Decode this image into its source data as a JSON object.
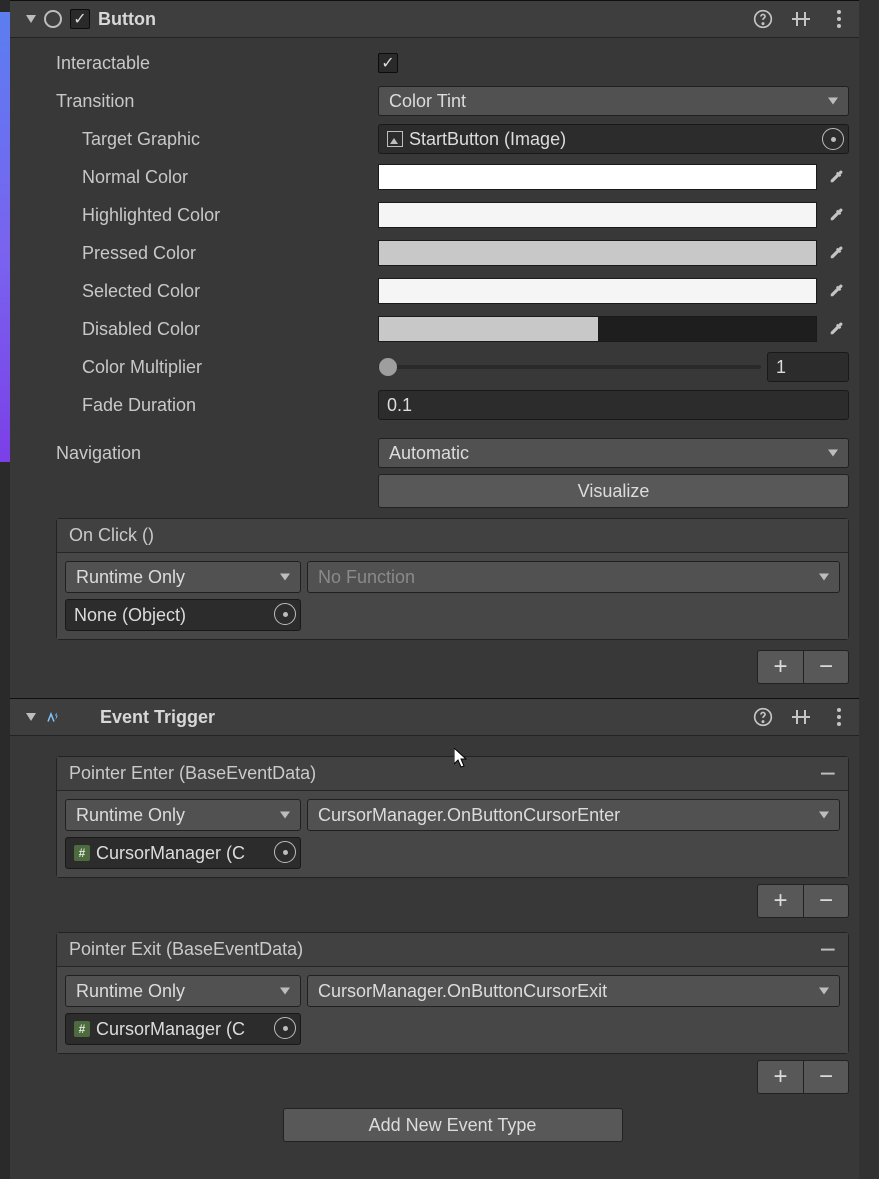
{
  "button": {
    "title": "Button",
    "enabled": true,
    "interactable_label": "Interactable",
    "interactable_on": true,
    "transition_label": "Transition",
    "transition_value": "Color Tint",
    "target_graphic_label": "Target Graphic",
    "target_graphic_value": "StartButton (Image)",
    "normal_color_label": "Normal Color",
    "normal_color_value": "#ffffff",
    "highlighted_color_label": "Highlighted Color",
    "highlighted_color_value": "#f5f5f5",
    "pressed_color_label": "Pressed Color",
    "pressed_color_value": "#c8c8c8",
    "selected_color_label": "Selected Color",
    "selected_color_value": "#f5f5f5",
    "disabled_color_label": "Disabled Color",
    "disabled_color_a": "#c8c8c8",
    "disabled_color_b": "#1e1e1e",
    "color_multiplier_label": "Color Multiplier",
    "color_multiplier_value": "1",
    "fade_duration_label": "Fade Duration",
    "fade_duration_value": "0.1",
    "navigation_label": "Navigation",
    "navigation_value": "Automatic",
    "visualize_label": "Visualize",
    "onclick": {
      "header": "On Click ()",
      "callstate": "Runtime Only",
      "target": "None (Object)",
      "func": "No Function"
    }
  },
  "event_trigger": {
    "title": "Event Trigger",
    "add_new_label": "Add New Event Type",
    "events": [
      {
        "header": "Pointer Enter (BaseEventData)",
        "callstate": "Runtime Only",
        "target": "CursorManager (C",
        "func": "CursorManager.OnButtonCursorEnter"
      },
      {
        "header": "Pointer Exit (BaseEventData)",
        "callstate": "Runtime Only",
        "target": "CursorManager (C",
        "func": "CursorManager.OnButtonCursorExit"
      }
    ]
  }
}
